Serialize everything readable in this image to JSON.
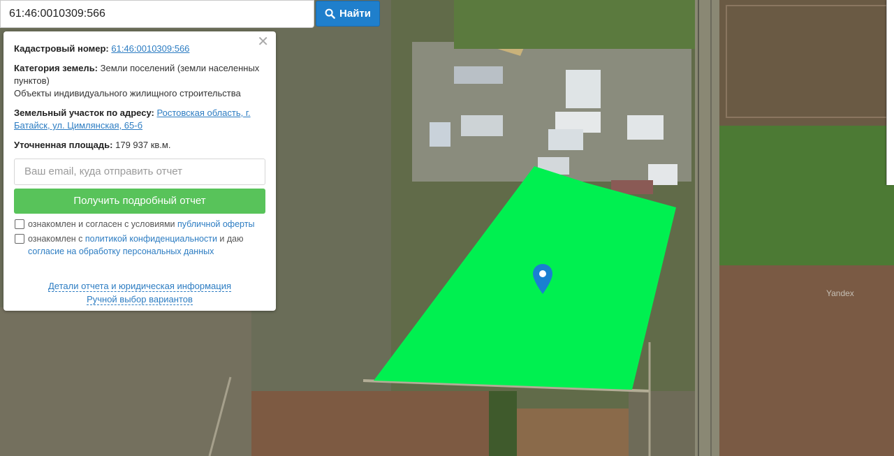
{
  "search": {
    "value": "61:46:0010309:566",
    "button_label": "Найти"
  },
  "panel": {
    "cadastral": {
      "label": "Кадастровый номер:",
      "value": "61:46:0010309:566"
    },
    "category": {
      "label": "Категория земель:",
      "value": "Земли поселений (земли населенных пунктов)",
      "usage": "Объекты индивидуального жилищного строительства"
    },
    "address": {
      "label": "Земельный участок по адресу:",
      "value": "Ростовская область, г. Батайск, ул. Цимлянская, 65-б"
    },
    "area": {
      "label": "Уточненная площадь:",
      "value": "179 937 кв.м."
    },
    "email_placeholder": "Ваш email, куда отправить отчет",
    "report_button": "Получить подробный отчет",
    "consent1": {
      "text": "ознакомлен и согласен с условиями ",
      "link": "публичной оферты"
    },
    "consent2": {
      "text": "ознакомлен с ",
      "link1": "политикой конфиденциальности",
      "mid": " и даю ",
      "link2": "согласие на обработку персональных данных"
    },
    "details_link": "Детали отчета и юридическая информация",
    "manual_link": "Ручной выбор вариантов"
  },
  "map": {
    "watermark": "Yandex",
    "parcel_color": "#00f050",
    "marker_color": "#1a7fd1"
  }
}
